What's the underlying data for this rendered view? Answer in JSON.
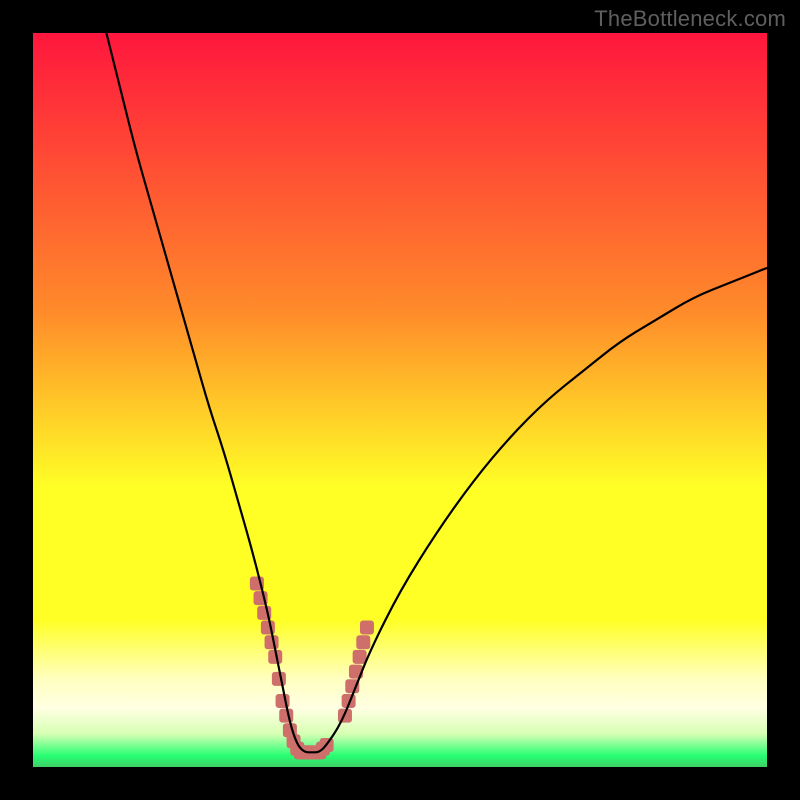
{
  "watermark": "TheBottleneck.com",
  "palette": {
    "black": "#000000",
    "red_top": "#ff163d",
    "orange": "#ffa126",
    "yellow": "#ffff26",
    "cream": "#ffffb0",
    "green": "#26ff72",
    "curve": "#000000",
    "marker": "#cf6f6b"
  },
  "chart_data": {
    "type": "line",
    "title": "",
    "xlabel": "",
    "ylabel": "",
    "xlim": [
      0,
      100
    ],
    "ylim": [
      0,
      100
    ],
    "grid": false,
    "legend": false,
    "series": [
      {
        "name": "bottleneck-curve",
        "x": [
          10,
          12,
          14,
          16,
          18,
          20,
          22,
          24,
          26,
          28,
          30,
          32,
          33,
          34,
          35,
          36,
          37,
          38,
          39,
          40,
          42,
          44,
          46,
          50,
          55,
          60,
          65,
          70,
          75,
          80,
          85,
          90,
          95,
          100
        ],
        "y": [
          100,
          92,
          84,
          77,
          70,
          63,
          56,
          49,
          43,
          36,
          29,
          21,
          16,
          11,
          6,
          3,
          2,
          2,
          2,
          3,
          6,
          11,
          16,
          24,
          32,
          39,
          45,
          50,
          54,
          58,
          61,
          64,
          66,
          68
        ]
      }
    ],
    "markers": {
      "name": "highlight-segments",
      "points_x": [
        30.5,
        31,
        31.5,
        32,
        32.5,
        33,
        33.5,
        34,
        34.5,
        35,
        35.5,
        36,
        36.5,
        37,
        37.5,
        38,
        38.5,
        39,
        39.5,
        40,
        42.5,
        43,
        43.5,
        44,
        44.5,
        45,
        45.5
      ],
      "points_y": [
        25,
        23,
        21,
        19,
        17,
        15,
        12,
        9,
        7,
        5,
        3.5,
        2.5,
        2,
        2,
        2,
        2,
        2,
        2,
        2.5,
        3,
        7,
        9,
        11,
        13,
        15,
        17,
        19
      ]
    },
    "gradient_stops": [
      {
        "pos": 0.0,
        "color": "#ff163d"
      },
      {
        "pos": 0.38,
        "color": "#ff8b2a"
      },
      {
        "pos": 0.62,
        "color": "#ffff26"
      },
      {
        "pos": 0.8,
        "color": "#ffff26"
      },
      {
        "pos": 0.88,
        "color": "#ffffc0"
      },
      {
        "pos": 0.92,
        "color": "#ffffe2"
      },
      {
        "pos": 0.955,
        "color": "#d6ffb3"
      },
      {
        "pos": 0.985,
        "color": "#26ff72"
      },
      {
        "pos": 1.0,
        "color": "#3fcf66"
      }
    ]
  }
}
